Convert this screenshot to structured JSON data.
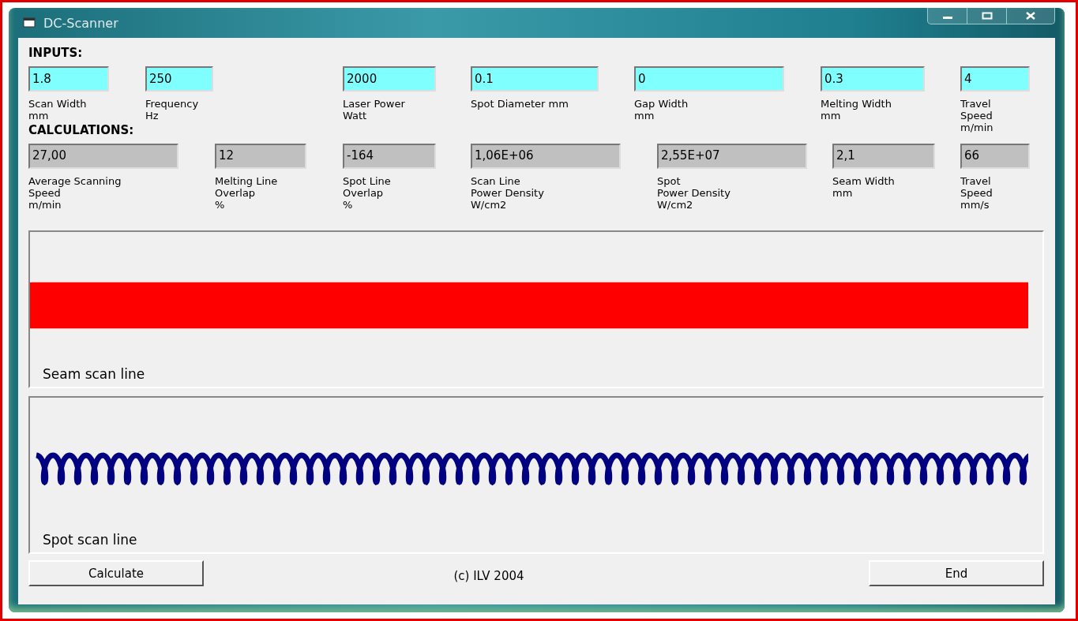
{
  "window": {
    "title": "DC-Scanner"
  },
  "inputs": {
    "heading": "INPUTS:",
    "fields": [
      {
        "value": "1.8",
        "label": "Scan Width\nmm"
      },
      {
        "value": "250",
        "label": "Frequency\nHz"
      },
      {
        "value": "2000",
        "label": "Laser Power\nWatt"
      },
      {
        "value": "0.1",
        "label": "Spot Diameter  mm"
      },
      {
        "value": "0",
        "label": "Gap Width\nmm"
      },
      {
        "value": "0.3",
        "label": "Melting Width\nmm"
      },
      {
        "value": "4",
        "label": "Travel\nSpeed\nm/min"
      }
    ]
  },
  "calculations": {
    "heading": "CALCULATIONS:",
    "fields": [
      {
        "value": "27,00",
        "label": "Average Scanning\nSpeed\nm/min"
      },
      {
        "value": "12",
        "label": "Melting Line\nOverlap\n%"
      },
      {
        "value": "-164",
        "label": "Spot Line\nOverlap\n%"
      },
      {
        "value": "1,06E+06",
        "label": "Scan Line\nPower Density\nW/cm2"
      },
      {
        "value": "2,55E+07",
        "label": "Spot\nPower Density\nW/cm2"
      },
      {
        "value": "2,1",
        "label": "Seam Width\nmm"
      },
      {
        "value": "66",
        "label": "Travel\nSpeed\nmm/s"
      }
    ]
  },
  "plots": [
    {
      "kind": "band",
      "label": "Seam scan line"
    },
    {
      "kind": "loops",
      "label": "Spot scan line"
    }
  ],
  "buttons": [
    {
      "label": "Calculate"
    },
    {
      "label": "End"
    }
  ],
  "footer": "(c) ILV 2004"
}
